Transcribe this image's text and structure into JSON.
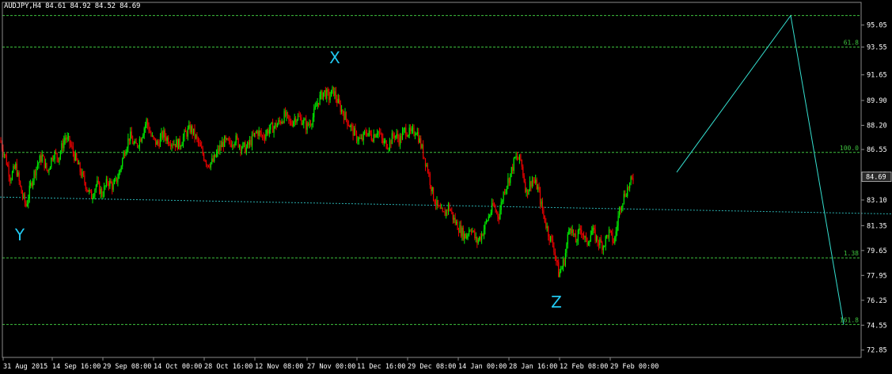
{
  "header": "AUDJPY,H4  84.61 84.92 84.52 84.69",
  "colors": {
    "background": "#000000",
    "grid": "#8a8a8a",
    "bull": "#00ee00",
    "bear": "#ee0000",
    "level": "#3ec23e",
    "trend": "#2ab0b0",
    "projection": "#35e0d0",
    "wave_label": "#21c8f0",
    "price_tag_bg": "#2a2a2a"
  },
  "chart_data": {
    "type": "candlestick",
    "symbol": "AUDJPY",
    "timeframe": "H4",
    "ohlc_current": {
      "open": 84.61,
      "high": 84.92,
      "low": 84.52,
      "close": 84.69
    },
    "current_price_label": "84.69",
    "ylim": [
      72.35,
      96.6
    ],
    "y_ticks": [
      "95.05",
      "93.55",
      "91.65",
      "89.90",
      "88.20",
      "86.55",
      "84.85",
      "83.10",
      "81.35",
      "79.65",
      "77.95",
      "76.25",
      "74.55",
      "72.85"
    ],
    "x_ticks": [
      "31 Aug 2015",
      "14 Sep 16:00",
      "29 Sep 08:00",
      "14 Oct 00:00",
      "28 Oct 16:00",
      "12 Nov 08:00",
      "27 Nov 00:00",
      "11 Dec 16:00",
      "29 Dec 08:00",
      "14 Jan 00:00",
      "28 Jan 16:00",
      "12 Feb 08:00",
      "29 Feb 00:00"
    ],
    "price_path": [
      [
        0,
        87.2
      ],
      [
        7,
        86.0
      ],
      [
        13,
        84.6
      ],
      [
        20,
        85.4
      ],
      [
        27,
        83.6
      ],
      [
        33,
        82.7
      ],
      [
        40,
        84.4
      ],
      [
        46,
        85.4
      ],
      [
        53,
        86.1
      ],
      [
        60,
        85.0
      ],
      [
        67,
        86.3
      ],
      [
        74,
        86.0
      ],
      [
        82,
        87.4
      ],
      [
        88,
        87.0
      ],
      [
        94,
        86.1
      ],
      [
        101,
        85.1
      ],
      [
        108,
        84.2
      ],
      [
        115,
        83.3
      ],
      [
        122,
        84.2
      ],
      [
        129,
        83.5
      ],
      [
        136,
        84.4
      ],
      [
        143,
        84.0
      ],
      [
        150,
        84.8
      ],
      [
        157,
        86.4
      ],
      [
        164,
        87.5
      ],
      [
        171,
        86.7
      ],
      [
        178,
        87.4
      ],
      [
        185,
        88.5
      ],
      [
        192,
        87.3
      ],
      [
        199,
        86.9
      ],
      [
        206,
        87.6
      ],
      [
        213,
        87.2
      ],
      [
        220,
        87.0
      ],
      [
        227,
        86.9
      ],
      [
        234,
        87.6
      ],
      [
        241,
        88.0
      ],
      [
        248,
        87.3
      ],
      [
        255,
        86.4
      ],
      [
        262,
        85.6
      ],
      [
        269,
        85.7
      ],
      [
        276,
        86.5
      ],
      [
        283,
        87.1
      ],
      [
        290,
        86.9
      ],
      [
        297,
        87.3
      ],
      [
        304,
        86.8
      ],
      [
        311,
        86.6
      ],
      [
        318,
        87.2
      ],
      [
        325,
        87.8
      ],
      [
        332,
        87.4
      ],
      [
        339,
        87.9
      ],
      [
        346,
        88.1
      ],
      [
        353,
        88.4
      ],
      [
        360,
        88.9
      ],
      [
        367,
        88.3
      ],
      [
        374,
        88.8
      ],
      [
        381,
        88.6
      ],
      [
        388,
        88.1
      ],
      [
        395,
        88.7
      ],
      [
        402,
        89.9
      ],
      [
        409,
        90.5
      ],
      [
        416,
        90.1
      ],
      [
        421,
        90.6
      ],
      [
        428,
        89.6
      ],
      [
        435,
        88.9
      ],
      [
        442,
        88.2
      ],
      [
        449,
        87.5
      ],
      [
        456,
        87.1
      ],
      [
        463,
        87.8
      ],
      [
        470,
        87.4
      ],
      [
        477,
        87.9
      ],
      [
        484,
        87.0
      ],
      [
        491,
        86.9
      ],
      [
        498,
        87.6
      ],
      [
        505,
        87.2
      ],
      [
        512,
        87.9
      ],
      [
        519,
        87.6
      ],
      [
        526,
        87.9
      ],
      [
        533,
        86.6
      ],
      [
        540,
        85.3
      ],
      [
        547,
        83.4
      ],
      [
        553,
        82.6
      ],
      [
        560,
        82.0
      ],
      [
        567,
        82.7
      ],
      [
        574,
        81.7
      ],
      [
        581,
        81.1
      ],
      [
        588,
        80.6
      ],
      [
        595,
        81.3
      ],
      [
        602,
        80.2
      ],
      [
        609,
        80.8
      ],
      [
        616,
        81.8
      ],
      [
        623,
        82.7
      ],
      [
        630,
        82.0
      ],
      [
        637,
        83.8
      ],
      [
        644,
        84.7
      ],
      [
        651,
        86.0
      ],
      [
        658,
        85.8
      ],
      [
        665,
        83.6
      ],
      [
        672,
        84.5
      ],
      [
        679,
        84.0
      ],
      [
        686,
        82.2
      ],
      [
        693,
        80.8
      ],
      [
        700,
        79.8
      ],
      [
        706,
        78.0
      ],
      [
        713,
        79.0
      ],
      [
        720,
        81.5
      ],
      [
        727,
        80.2
      ],
      [
        734,
        81.2
      ],
      [
        741,
        80.1
      ],
      [
        748,
        81.0
      ],
      [
        755,
        80.3
      ],
      [
        762,
        80.0
      ],
      [
        769,
        80.9
      ],
      [
        776,
        80.2
      ],
      [
        783,
        82.6
      ],
      [
        790,
        83.6
      ],
      [
        795,
        84.1
      ],
      [
        801,
        84.69
      ]
    ],
    "levels": [
      {
        "label": "",
        "value": 95.7
      },
      {
        "label": "61.8",
        "value": 93.55
      },
      {
        "label": "100.0",
        "value": 86.35
      },
      {
        "label": "1.38",
        "value": 79.15
      },
      {
        "label": "161.8",
        "value": 74.6
      }
    ],
    "trendline": {
      "points": [
        [
          0,
          83.3
        ],
        [
          1127,
          82.15
        ]
      ]
    },
    "projection": {
      "points": [
        [
          855,
          85.0
        ],
        [
          999,
          95.7
        ],
        [
          1066,
          74.6
        ]
      ]
    },
    "wave_labels": [
      {
        "text": "Y",
        "x": 25,
        "y": 80.35
      },
      {
        "text": "X",
        "x": 423,
        "y": 92.45
      },
      {
        "text": "Z",
        "x": 703,
        "y": 75.75
      }
    ]
  }
}
